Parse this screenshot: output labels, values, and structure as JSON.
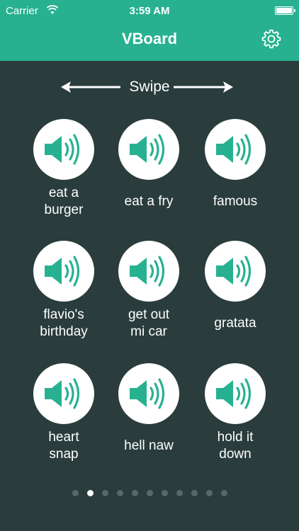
{
  "status_bar": {
    "carrier": "Carrier",
    "time": "3:59 AM"
  },
  "header": {
    "title": "VBoard",
    "settings_icon": "gear-icon"
  },
  "swipe": {
    "label": "Swipe"
  },
  "colors": {
    "accent": "#27b190",
    "background": "#2a3c3c"
  },
  "sounds": [
    {
      "label": "eat a\nburger",
      "icon": "speaker-icon"
    },
    {
      "label": "eat a fry",
      "icon": "speaker-icon"
    },
    {
      "label": "famous",
      "icon": "speaker-icon"
    },
    {
      "label": "flavio's\nbirthday",
      "icon": "speaker-icon"
    },
    {
      "label": "get out\nmi car",
      "icon": "speaker-icon"
    },
    {
      "label": "gratata",
      "icon": "speaker-icon"
    },
    {
      "label": "heart\nsnap",
      "icon": "speaker-icon"
    },
    {
      "label": "hell naw",
      "icon": "speaker-icon"
    },
    {
      "label": "hold it\ndown",
      "icon": "speaker-icon"
    }
  ],
  "pagination": {
    "total": 11,
    "current": 2
  }
}
